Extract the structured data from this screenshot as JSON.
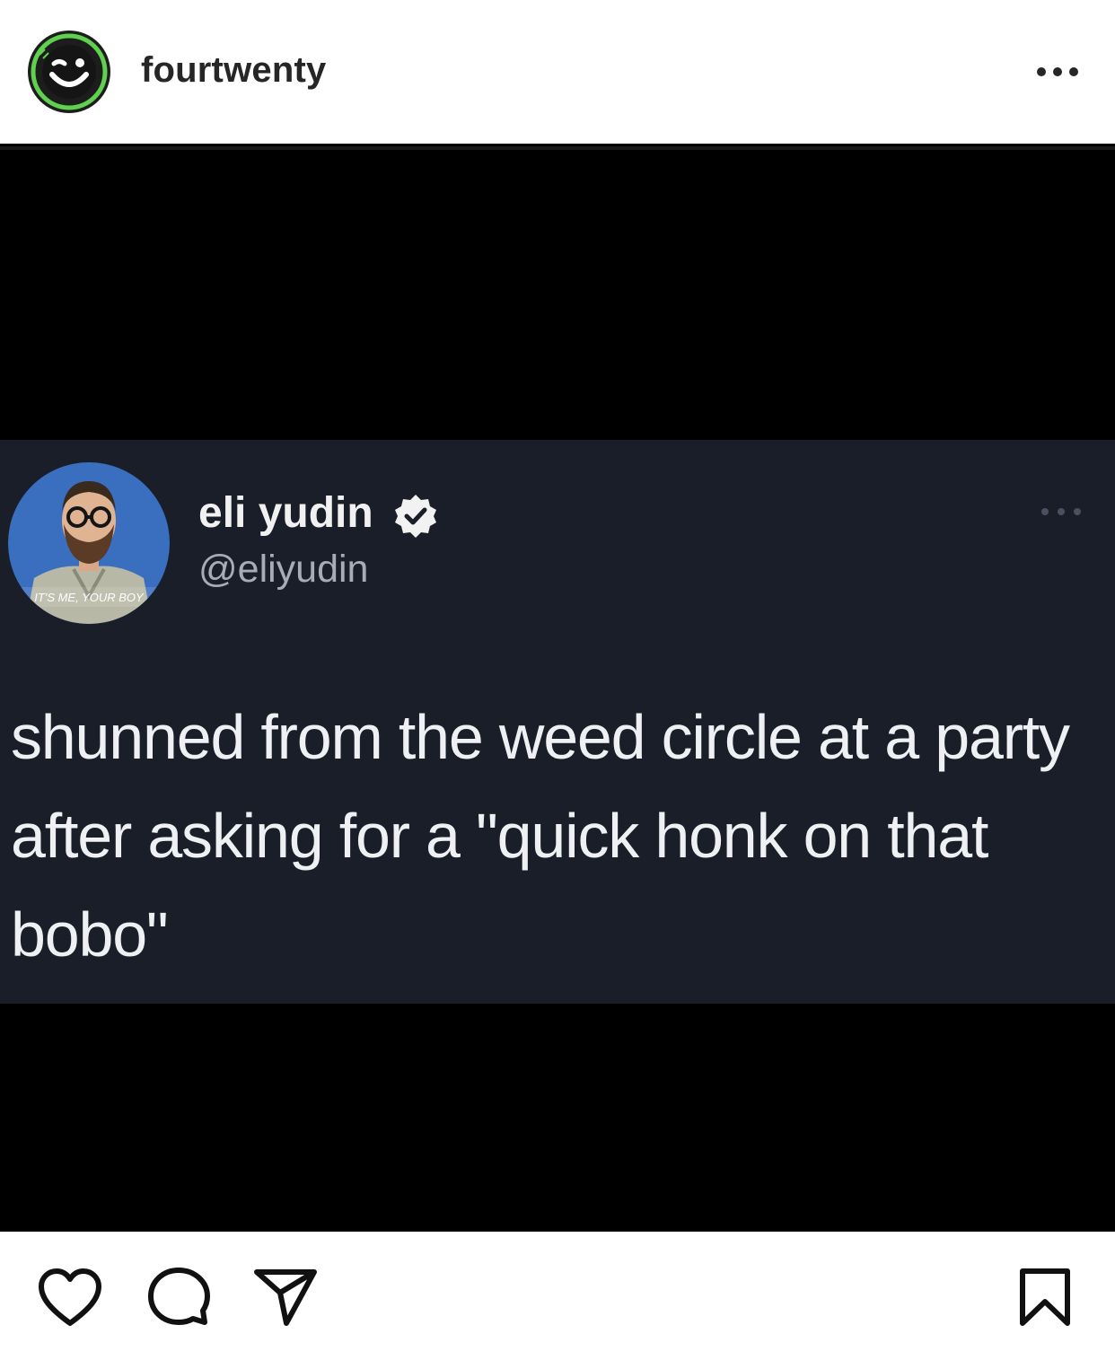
{
  "post": {
    "account_name": "fourtwenty",
    "more_options_icon": "more-horizontal-icon",
    "avatar_icon": "smiley-logo-icon"
  },
  "tweet": {
    "display_name": "eli yudin",
    "handle": "@eliyudin",
    "verified": true,
    "avatar_caption": "IT'S ME, YOUR BOY",
    "text": "shunned from the weed circle at a party after asking for a \"quick honk on that bobo\""
  },
  "actions": {
    "icons": [
      "heart-icon",
      "comment-icon",
      "share-icon",
      "bookmark-icon"
    ]
  },
  "colors": {
    "brand_green": "#5fd14f",
    "tweet_background": "#1a1e29",
    "media_background": "#000000"
  }
}
